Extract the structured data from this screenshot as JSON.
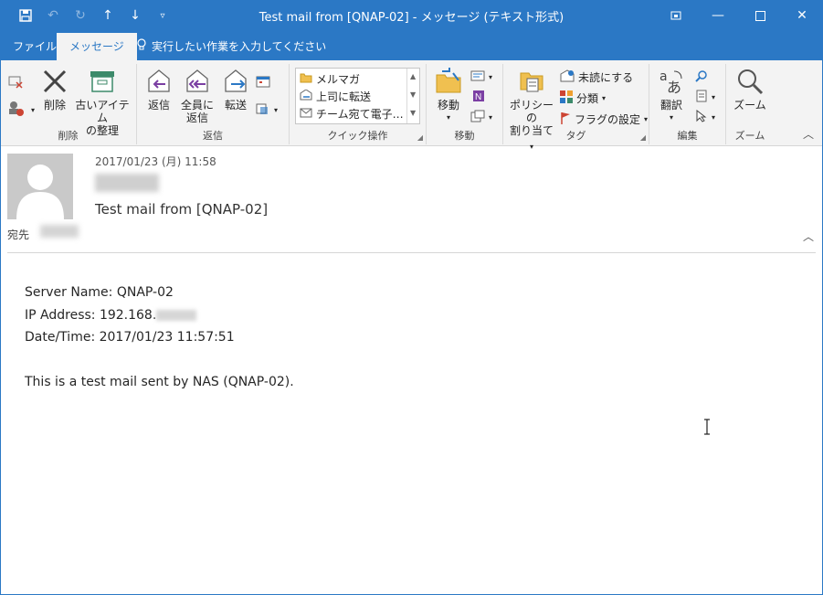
{
  "window": {
    "title": "Test mail from [QNAP-02] - メッセージ (テキスト形式)"
  },
  "tabs": [
    {
      "label": "ファイル"
    },
    {
      "label": "メッセージ"
    }
  ],
  "tellme": {
    "text": "実行したい作業を入力してください"
  },
  "ribbon": {
    "delete": {
      "delete_label": "削除",
      "archive_label_1": "古いアイテム",
      "archive_label_2": "の整理",
      "group": "削除"
    },
    "respond": {
      "reply": "返信",
      "reply_all_1": "全員に",
      "reply_all_2": "返信",
      "forward": "転送",
      "group": "返信"
    },
    "quick_steps": {
      "items": [
        "メルマガ",
        "上司に転送",
        "チーム宛て電子…"
      ],
      "group": "クイック操作"
    },
    "move": {
      "move": "移動",
      "group": "移動"
    },
    "tags": {
      "policy_1": "ポリシーの",
      "policy_2": "割り当て",
      "unread": "未読にする",
      "categorize": "分類",
      "followup": "フラグの設定",
      "group": "タグ"
    },
    "editing": {
      "translate": "翻訳",
      "group": "編集"
    },
    "zoom": {
      "zoom": "ズーム",
      "group": "ズーム"
    }
  },
  "message": {
    "datetime": "2017/01/23 (月) 11:58",
    "subject": "Test mail from [QNAP-02]",
    "to_label": "宛先",
    "body": {
      "server": "Server Name: QNAP-02",
      "ip_prefix": "IP Address: 192.168.",
      "datetime": "Date/Time: 2017/01/23 11:57:51",
      "note": "This is a test mail sent by NAS (QNAP-02)."
    }
  },
  "colors": {
    "accent": "#2b78c5",
    "ribbon_bg": "#f3f3f3"
  },
  "icons": [
    "save-icon",
    "undo-icon",
    "redo-icon",
    "up-arrow-icon",
    "down-arrow-icon",
    "customize-qat-icon",
    "restore-icon",
    "minimize-icon",
    "maximize-icon",
    "close-icon",
    "lightbulb-icon",
    "ignore-icon",
    "junk-icon",
    "delete-icon",
    "archive-icon",
    "reply-icon",
    "reply-all-icon",
    "forward-icon",
    "meeting-icon",
    "more-respond-icon",
    "move-icon",
    "rules-icon",
    "onenote-icon",
    "actions-icon",
    "policy-icon",
    "unread-icon",
    "categorize-icon",
    "flag-icon",
    "translate-icon",
    "find-icon",
    "related-icon",
    "select-icon",
    "zoom-icon",
    "avatar",
    "ibeam-cursor"
  ]
}
